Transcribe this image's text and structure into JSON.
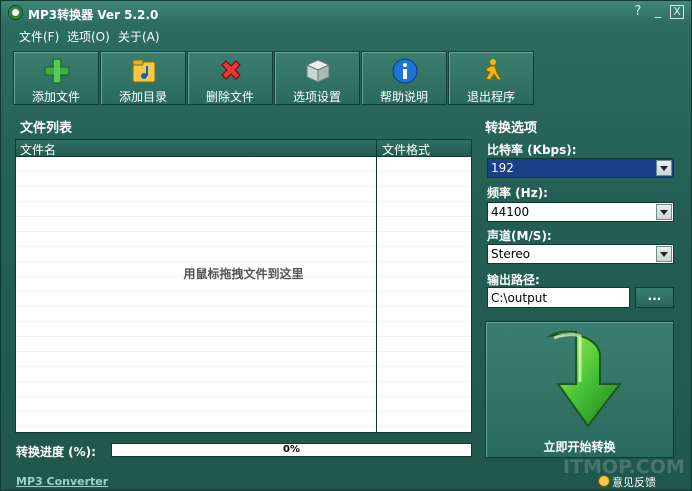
{
  "window": {
    "title": "MP3转换器 Ver 5.2.0",
    "help": "?",
    "minimize": "_",
    "close": "X"
  },
  "menu": [
    "文件(F)",
    "选项(O)",
    "关于(A)"
  ],
  "toolbar": [
    {
      "label": "添加文件",
      "icon": "plus-icon"
    },
    {
      "label": "添加目录",
      "icon": "folder-music-icon"
    },
    {
      "label": "删除文件",
      "icon": "delete-x-icon"
    },
    {
      "label": "选项设置",
      "icon": "cube-settings-icon"
    },
    {
      "label": "帮助说明",
      "icon": "info-icon"
    },
    {
      "label": "退出程序",
      "icon": "runner-exit-icon"
    }
  ],
  "file_list": {
    "title": "文件列表",
    "columns": [
      "文件名",
      "文件格式"
    ],
    "empty_hint": "用鼠标拖拽文件到这里"
  },
  "progress": {
    "label": "转换进度 (%):",
    "value": 0,
    "text": "0%"
  },
  "footer": {
    "app_link": "MP3 Converter",
    "feedback": "意见反馈",
    "watermark": "ITMOP.COM"
  },
  "options": {
    "title": "转换选项",
    "bitrate": {
      "label": "比特率 (Kbps):",
      "value": "192"
    },
    "frequency": {
      "label": "频率 (Hz):",
      "value": "44100"
    },
    "channel": {
      "label": "声道(M/S):",
      "value": "Stereo"
    },
    "output": {
      "label": "输出路径:",
      "value": "C:\\output",
      "browse": "..."
    },
    "start": {
      "label": "立即开始转换"
    }
  }
}
